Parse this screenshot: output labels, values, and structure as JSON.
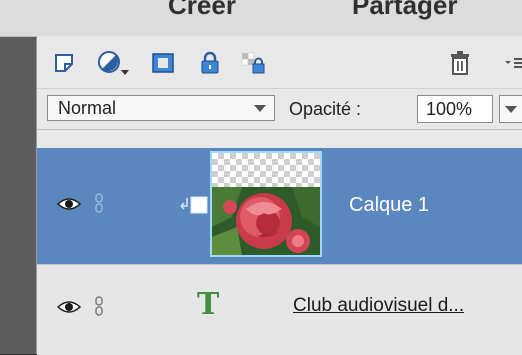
{
  "top_tabs": [
    {
      "label": "Créer"
    },
    {
      "label": "Partager"
    }
  ],
  "toolbar": {
    "icons": [
      "new-layer-icon",
      "adjustment-layer-icon",
      "add-mask-icon",
      "lock-icon",
      "lock-transparency-icon",
      "trash-icon",
      "panel-menu-icon"
    ]
  },
  "blend": {
    "mode": "Normal",
    "opacity_label": "Opacité :",
    "opacity_value": "100%"
  },
  "layers": [
    {
      "name": "Calque 1",
      "selected": true,
      "type": "image"
    },
    {
      "name": "Club audiovisuel  d...",
      "selected": false,
      "type": "text",
      "icon_glyph": "T"
    }
  ],
  "colors": {
    "selected_row": "#5b87bf",
    "panel_bg": "#e8e8e8",
    "thumb_border": "#9fd8ff",
    "text_icon": "#3f8f3f"
  }
}
